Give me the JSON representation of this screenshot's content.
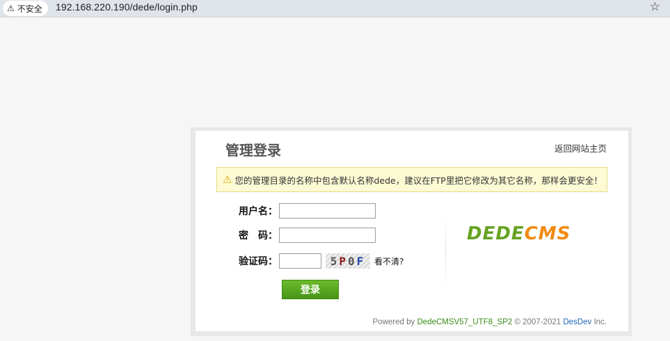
{
  "browser": {
    "security_label": "不安全",
    "url": "192.168.220.190/dede/login.php"
  },
  "login": {
    "title": "管理登录",
    "home_link": "返回网站主页",
    "warning": "您的管理目录的名称中包含默认名称dede，建议在FTP里把它修改为其它名称，那样会更安全！",
    "username_label": "用户名：",
    "username_value": "",
    "password_label": "密　码：",
    "password_value": "",
    "captcha_label": "验证码：",
    "captcha_value": "",
    "captcha_chars": [
      "5",
      "P",
      "0",
      "F"
    ],
    "cant_see": "看不清?",
    "submit_label": "登录"
  },
  "logo": {
    "part1": "DEDE",
    "part2": "CMS",
    "colors": {
      "part1": "#67a324",
      "part2": "#f08a12"
    }
  },
  "footer": {
    "powered_by": "Powered by",
    "product": "DedeCMSV57_UTF8_SP2",
    "copyright": "© 2007-2021",
    "company": "DesDev",
    "inc": "Inc."
  },
  "icons": {
    "warning": "warning-triangle-icon",
    "bookmark": "star-icon"
  }
}
